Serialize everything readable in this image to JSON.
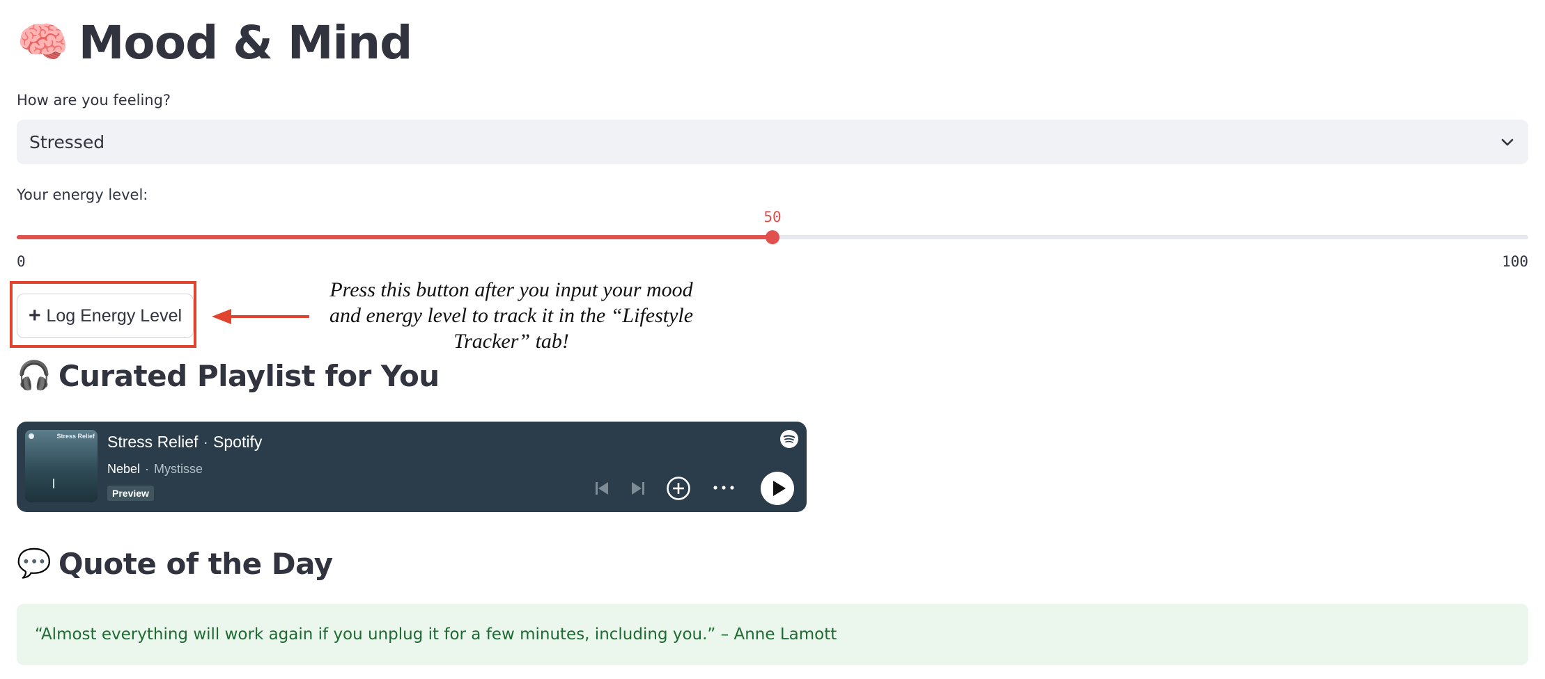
{
  "header": {
    "emoji": "🧠",
    "title": "Mood & Mind"
  },
  "mood": {
    "label": "How are you feeling?",
    "selected": "Stressed"
  },
  "energy": {
    "label": "Your energy level:",
    "value": 50,
    "value_text": "50",
    "min": "0",
    "max": "100"
  },
  "log_button": {
    "icon": "plus-icon",
    "label": "Log Energy Level"
  },
  "annotation": {
    "text": "Press this button after you input your mood and energy level to track it in the “Lifestyle Tracker” tab!",
    "color": "#e0442f"
  },
  "playlist_section": {
    "emoji": "🎧",
    "heading": "Curated Playlist for You"
  },
  "spotify": {
    "playlist": "Stress Relief",
    "provider": "Spotify",
    "track": "Nebel",
    "artist": "Mystisse",
    "badge": "Preview",
    "cover_text": "Stress Relief",
    "background": "#2b3d4a"
  },
  "quote_section": {
    "emoji": "💬",
    "heading": "Quote of the Day"
  },
  "quote": {
    "text": "“Almost everything will work again if you unplug it for a few minutes, including you.” – Anne Lamott"
  },
  "colors": {
    "accent": "#e0514e",
    "quote_bg": "#ebf6ec",
    "quote_text": "#1e6b33"
  }
}
